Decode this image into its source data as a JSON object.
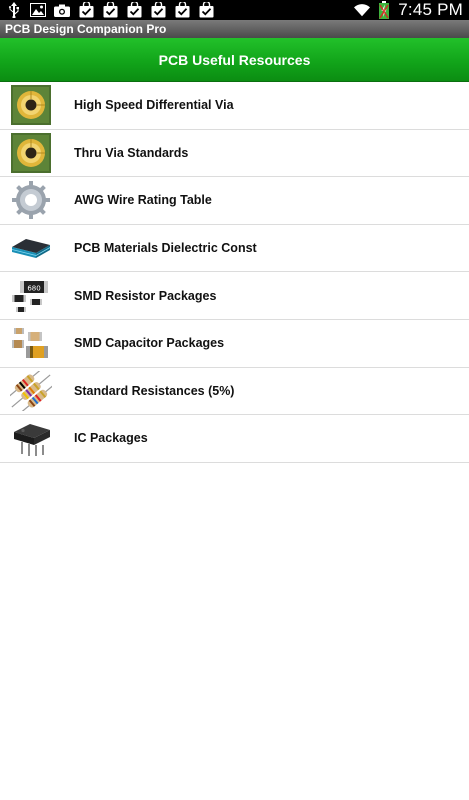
{
  "status_bar": {
    "left_icons": [
      "usb-icon",
      "gallery-icon",
      "camera-icon",
      "check-bag-icon",
      "check-bag-icon",
      "check-bag-icon",
      "check-bag-icon",
      "check-bag-icon",
      "check-bag-icon"
    ],
    "right_icons": [
      "wifi-icon",
      "battery-charging-icon"
    ],
    "time": "7:45 PM"
  },
  "app_title": "PCB Design Companion Pro",
  "header": {
    "title": "PCB Useful Resources"
  },
  "items": [
    {
      "label": "High Speed Differential Via",
      "icon": "via-icon"
    },
    {
      "label": "Thru Via Standards",
      "icon": "via-icon"
    },
    {
      "label": "AWG Wire Rating Table",
      "icon": "gear-wire-icon"
    },
    {
      "label": "PCB Materials Dielectric Const",
      "icon": "pcb-layer-icon"
    },
    {
      "label": "SMD Resistor Packages",
      "icon": "smd-resistor-icon"
    },
    {
      "label": "SMD Capacitor Packages",
      "icon": "smd-capacitor-icon"
    },
    {
      "label": "Standard Resistances (5%)",
      "icon": "resistors-icon"
    },
    {
      "label": "IC Packages",
      "icon": "ic-chip-icon"
    }
  ],
  "colors": {
    "header_green": "#12a51a",
    "status_bar": "#000000",
    "title_bar": "#5a5a5a"
  }
}
